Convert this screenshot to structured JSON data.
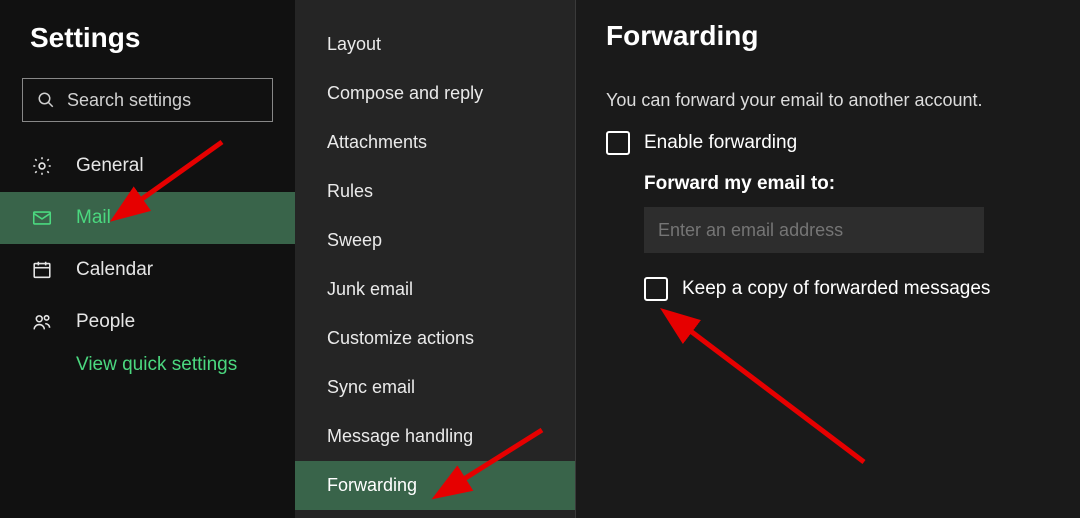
{
  "page_title": "Settings",
  "search_placeholder": "Search settings",
  "categories": [
    {
      "key": "general",
      "label": "General",
      "icon": "gear-icon",
      "active": false
    },
    {
      "key": "mail",
      "label": "Mail",
      "icon": "mail-icon",
      "active": true
    },
    {
      "key": "calendar",
      "label": "Calendar",
      "icon": "calendar-icon",
      "active": false
    },
    {
      "key": "people",
      "label": "People",
      "icon": "people-icon",
      "active": false
    }
  ],
  "view_quick_label": "View quick settings",
  "mail_subnav": [
    {
      "key": "layout",
      "label": "Layout",
      "active": false
    },
    {
      "key": "compose",
      "label": "Compose and reply",
      "active": false
    },
    {
      "key": "attachments",
      "label": "Attachments",
      "active": false
    },
    {
      "key": "rules",
      "label": "Rules",
      "active": false
    },
    {
      "key": "sweep",
      "label": "Sweep",
      "active": false
    },
    {
      "key": "junk",
      "label": "Junk email",
      "active": false
    },
    {
      "key": "customize",
      "label": "Customize actions",
      "active": false
    },
    {
      "key": "sync",
      "label": "Sync email",
      "active": false
    },
    {
      "key": "message-handling",
      "label": "Message handling",
      "active": false
    },
    {
      "key": "forwarding",
      "label": "Forwarding",
      "active": true
    }
  ],
  "main": {
    "title": "Forwarding",
    "description": "You can forward your email to another account.",
    "enable_label": "Enable forwarding",
    "forward_to_label": "Forward my email to:",
    "email_placeholder": "Enter an email address",
    "keep_copy_label": "Keep a copy of forwarded messages"
  }
}
